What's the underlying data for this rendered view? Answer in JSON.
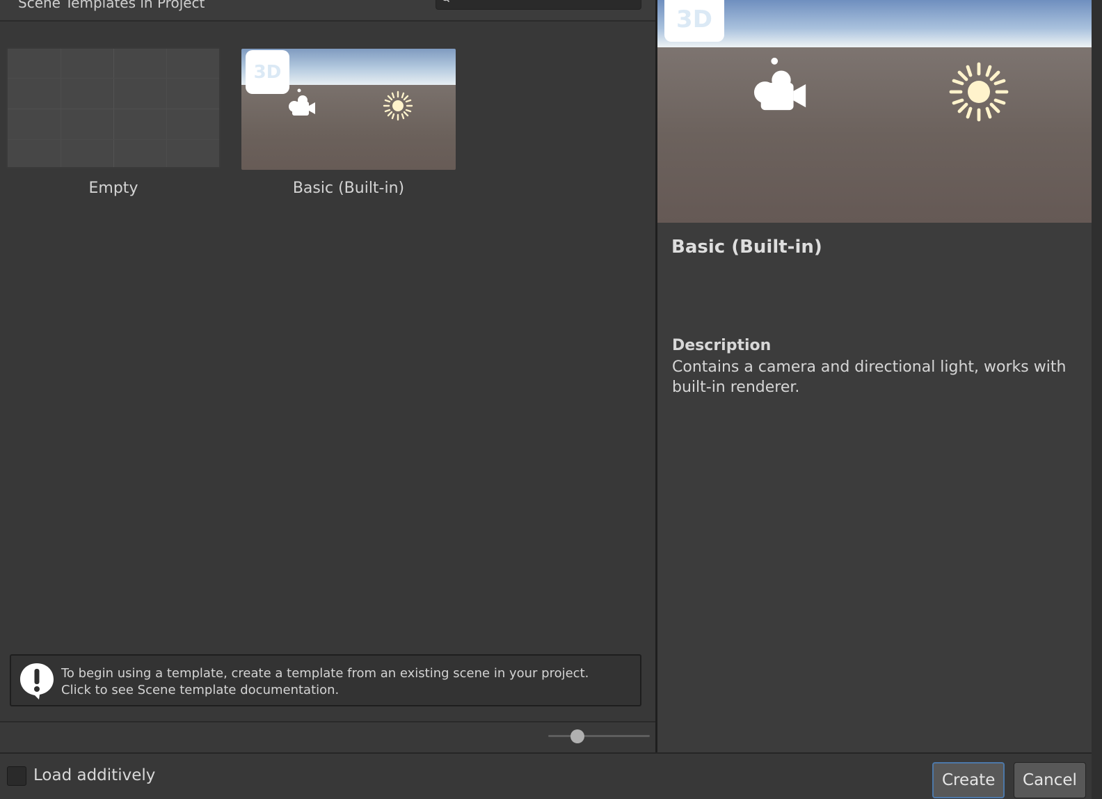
{
  "header": {
    "title": "Scene Templates in Project",
    "search_placeholder": ""
  },
  "templates": [
    {
      "label": "Empty",
      "badge": ""
    },
    {
      "label": "Basic (Built-in)",
      "badge": "3D"
    }
  ],
  "info_bar": {
    "line1": "To begin using a template, create a template from an existing scene in your project.",
    "line2": "Click to see Scene template documentation."
  },
  "thumbnail_size_slider": {
    "value": 0.29
  },
  "details": {
    "badge": "3D",
    "title": "Basic (Built-in)",
    "description_heading": "Description",
    "description": "Contains a camera and directional light, works with built-in renderer."
  },
  "footer": {
    "load_additively_label": "Load additively",
    "load_additively_checked": false,
    "create_label": "Create",
    "cancel_label": "Cancel"
  },
  "colors": {
    "background": "#383838",
    "accent_border": "#4d78a8",
    "sun": "#fff3cc"
  },
  "icons": [
    "search-icon",
    "camera-icon",
    "sun-icon",
    "info-icon"
  ]
}
